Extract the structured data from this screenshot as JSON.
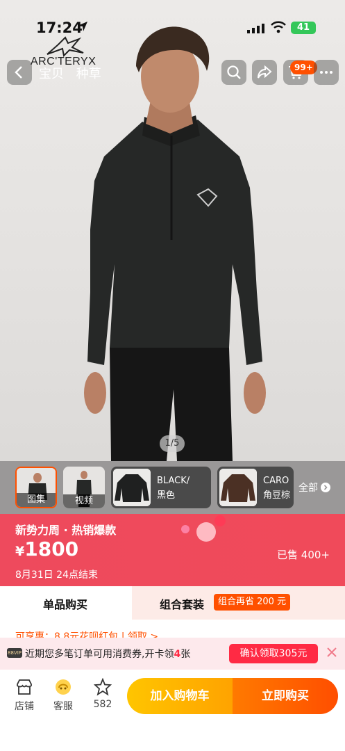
{
  "status_bar": {
    "time": "17:24",
    "battery": "41"
  },
  "header": {
    "brand_logo_text": "ARC'TERYX",
    "tabs": [
      "宝贝",
      "种草"
    ],
    "cart_badge": "99+"
  },
  "gallery": {
    "pager": "1/5"
  },
  "sku_strip": {
    "thumbs": [
      {
        "label": "图集"
      },
      {
        "label": "视频"
      }
    ],
    "variants": [
      {
        "name": "BLACK/",
        "sub": "黑色"
      },
      {
        "name": "CARO",
        "sub": "角豆棕"
      }
    ],
    "all_label": "全部"
  },
  "promo": {
    "title": "新势力周 · 热销爆款",
    "currency": "¥",
    "price": "1800",
    "sold": "已售 400+",
    "end_time": "8月31日 24点结束"
  },
  "purchase_tabs": {
    "single": "单品购买",
    "bundle": "组合套装",
    "bundle_tag": "组合再省 200 元"
  },
  "benefit_line": "可享惠：8.8元花呗红包 | 领取 >",
  "notice": {
    "vip": "88VIP",
    "text_before": "近期您多笔订单可用消费券,开卡领",
    "text_highlight": "4",
    "text_after": "张",
    "button": "确认领取305元"
  },
  "bottom_bar": {
    "shop": "店铺",
    "service": "客服",
    "favorites": "582",
    "add_to_cart": "加入购物车",
    "buy_now": "立即购买"
  },
  "colors": {
    "accent": "#ff5000",
    "promo_bg": "#ef4a5b",
    "cart_button": "#ffb300",
    "buy_button": "#ff6200"
  }
}
